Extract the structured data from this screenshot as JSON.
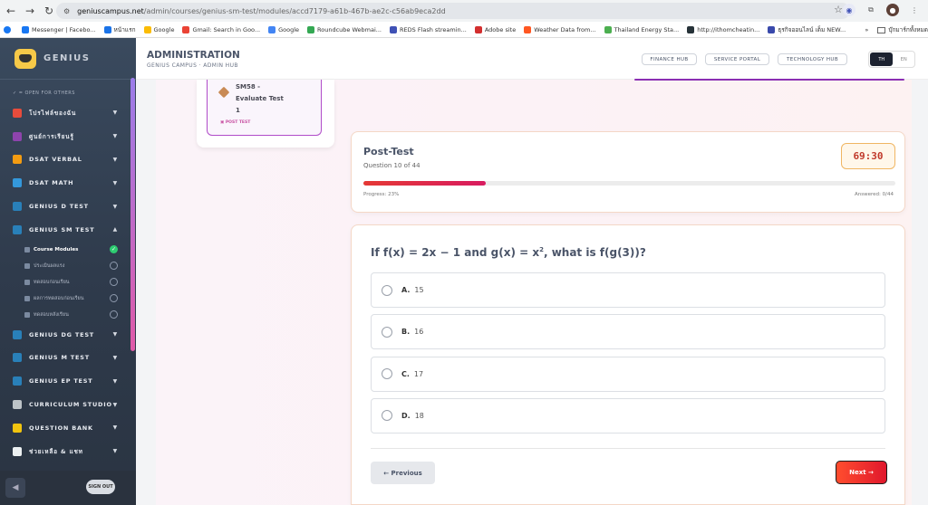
{
  "browser": {
    "url_host": "geniuscampus.net",
    "url_path": "/admin/courses/genius-sm-test/modules/accd7179-a61b-467b-ae2c-c56ab9eca2dd",
    "bookmarks": [
      "Messenger | Facebo...",
      "หน้าแรก",
      "Google",
      "Gmail: Search in Goo...",
      "Google",
      "Roundcube Webmai...",
      "REDS Flash streamin...",
      "Adobe site",
      "Weather Data from...",
      "Thailand Energy Sta...",
      "http://ithomcheatin...",
      "ธุรกิจออนไลน์ เต็ม NEW..."
    ],
    "bookmark_overflow": "»",
    "all_bookmarks": "บุ๊กมาร์กทั้งหมด"
  },
  "sidebar": {
    "logo": "GENIUS",
    "section_label": "✓ = OPEN FOR OTHERS",
    "items": [
      {
        "label": "โปรไฟล์ของฉัน",
        "color": "#e74c3c"
      },
      {
        "label": "ศูนย์การเรียนรู้",
        "color": "#8e44ad"
      },
      {
        "label": "DSAT VERBAL",
        "color": "#f39c12"
      },
      {
        "label": "DSAT MATH",
        "color": "#3498db"
      },
      {
        "label": "GENIUS D TEST",
        "color": "#2980b9"
      },
      {
        "label": "GENIUS SM TEST",
        "color": "#2980b9"
      }
    ],
    "subitems": [
      {
        "label": "Course Modules",
        "active": true
      },
      {
        "label": "ประเมินผลแรง",
        "active": false
      },
      {
        "label": "ทดสอบก่อนเรียน",
        "active": false
      },
      {
        "label": "ผลการทดสอบก่อนเรียน",
        "active": false
      },
      {
        "label": "ทดสอบหลังเรียน",
        "active": false
      }
    ],
    "items2": [
      {
        "label": "GENIUS DG TEST",
        "color": "#2980b9"
      },
      {
        "label": "GENIUS M TEST",
        "color": "#2980b9"
      },
      {
        "label": "GENIUS EP TEST",
        "color": "#2980b9"
      },
      {
        "label": "CURRICULUM STUDIO",
        "color": "#bdc3c7"
      },
      {
        "label": "QUESTION BANK",
        "color": "#f1c40f"
      },
      {
        "label": "ช่วยเหลือ & แชท",
        "color": "#ecf0f1"
      }
    ],
    "logout": "SIGN OUT"
  },
  "header": {
    "title": "ADMINISTRATION",
    "subtitle": "GENIUS CAMPUS · ADMIN HUB",
    "hubs": [
      "FINANCE HUB",
      "SERVICE PORTAL",
      "TECHNOLOGY HUB"
    ],
    "lang_th": "TH",
    "lang_en": "EN"
  },
  "module": {
    "name": "SM58 - Evaluate Test 1",
    "tag": "POST TEST"
  },
  "test": {
    "title": "Post-Test",
    "question_of": "Question 10 of 44",
    "timer": "69:30",
    "progress_label": "Progress: 23%",
    "progress_fraction": 0.23,
    "answered_label": "Answered: 0/44"
  },
  "question": {
    "text_pre": "If f(x) = 2x − 1 and g(x) = x",
    "text_sup": "2",
    "text_post": ", what is f(g(3))?",
    "options": [
      {
        "letter": "A.",
        "value": "15"
      },
      {
        "letter": "B.",
        "value": "16"
      },
      {
        "letter": "C.",
        "value": "17"
      },
      {
        "letter": "D.",
        "value": "18"
      }
    ],
    "prev_label": "← Previous",
    "next_label": "Next →"
  }
}
